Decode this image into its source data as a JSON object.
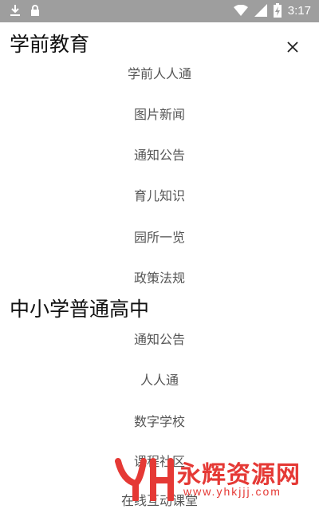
{
  "status_bar": {
    "time": "3:17",
    "icons": [
      "download-icon",
      "lock-icon",
      "wifi-icon",
      "signal-icon",
      "battery-charging-icon"
    ]
  },
  "close_icon": "close-icon",
  "sections": [
    {
      "title": "学前教育",
      "items": [
        "学前人人通",
        "图片新闻",
        "通知公告",
        "育儿知识",
        "园所一览",
        "政策法规"
      ]
    },
    {
      "title": "中小学普通高中",
      "items": [
        "通知公告",
        "人人通",
        "数字学校",
        "课程社区",
        "在线互动课堂"
      ]
    }
  ],
  "watermark": {
    "text": "永辉资源网",
    "url": "www.yhkjjj.com",
    "color": "#e53935"
  }
}
